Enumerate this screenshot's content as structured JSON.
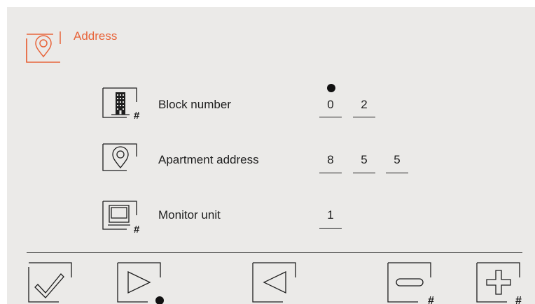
{
  "header": {
    "title": "Address",
    "icon": "location-pin-icon",
    "accent_color": "#e8643a"
  },
  "rows": [
    {
      "label": "Block number",
      "icon": "building-hash-icon",
      "digits": [
        "0",
        "2"
      ],
      "cursor_on_digit": 0
    },
    {
      "label": "Apartment address",
      "icon": "location-pin-icon",
      "digits": [
        "8",
        "5",
        "5"
      ]
    },
    {
      "label": "Monitor unit",
      "icon": "monitor-hash-icon",
      "digits": [
        "1"
      ]
    }
  ],
  "toolbar": {
    "buttons": [
      {
        "name": "confirm-button",
        "icon": "checkmark-icon"
      },
      {
        "name": "next-button",
        "icon": "play-right-icon",
        "selected": true
      },
      {
        "name": "previous-button",
        "icon": "back-left-icon"
      },
      {
        "name": "decrement-button",
        "icon": "minus-hash-icon",
        "badge": "#"
      },
      {
        "name": "increment-button",
        "icon": "plus-hash-icon",
        "badge": "#"
      }
    ]
  },
  "hash_symbol": "#"
}
